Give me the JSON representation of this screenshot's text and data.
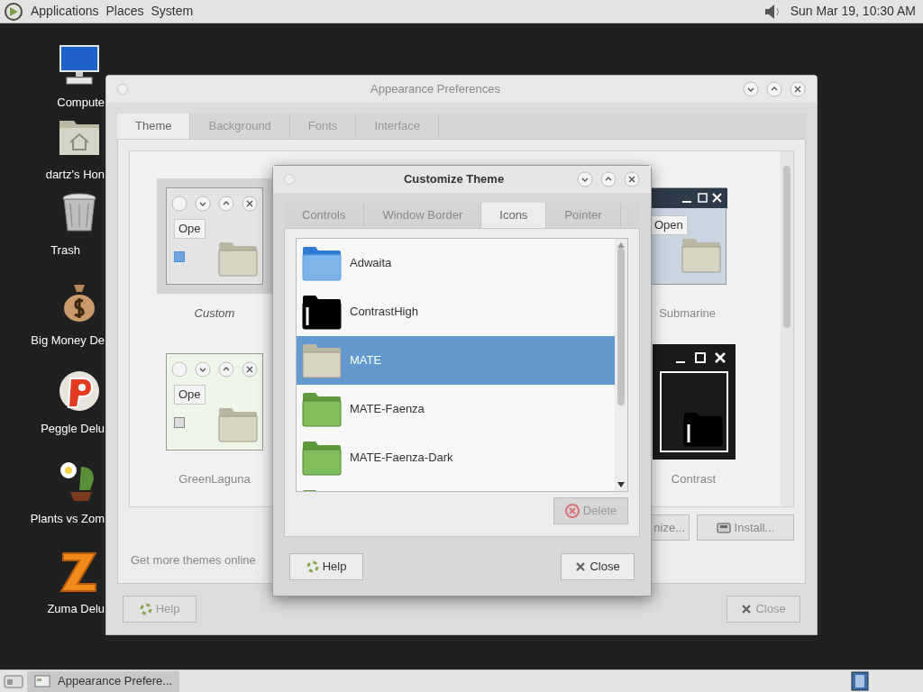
{
  "top_panel": {
    "menus": [
      {
        "label": "Applications"
      },
      {
        "label": "Places"
      },
      {
        "label": "System"
      }
    ],
    "clock": "Sun Mar 19, 10:30 AM"
  },
  "desktop_icons": [
    {
      "kind": "computer",
      "label": "Compute"
    },
    {
      "kind": "home",
      "label": "dartz's Hon"
    },
    {
      "kind": "trash",
      "label": "Trash"
    },
    {
      "kind": "money",
      "label": "Big Money De"
    },
    {
      "kind": "peggle",
      "label": "Peggle Delu"
    },
    {
      "kind": "plants",
      "label": "Plants vs Zom"
    },
    {
      "kind": "zuma",
      "label": "Zuma Delu"
    }
  ],
  "appearance_window": {
    "title": "Appearance Preferences",
    "active": false,
    "tabs": [
      {
        "label": "Theme",
        "selected": true
      },
      {
        "label": "Background",
        "selected": false
      },
      {
        "label": "Fonts",
        "selected": false
      },
      {
        "label": "Interface",
        "selected": false
      }
    ],
    "themes": [
      {
        "name": "Custom",
        "kind": "custom",
        "selected": true,
        "preview_button": "Ope"
      },
      {
        "name": "Submarine",
        "kind": "submarine",
        "selected": false,
        "preview_button": "Open"
      },
      {
        "name": "GreenLaguna",
        "kind": "green",
        "selected": false,
        "preview_button": "Ope"
      },
      {
        "name": "Contrast",
        "kind": "contrast",
        "selected": false
      }
    ],
    "link": "Get more themes online",
    "buttons": [
      {
        "kind": "customize",
        "label": "nize..."
      },
      {
        "kind": "install",
        "label": "Install..."
      }
    ],
    "footer_buttons": [
      {
        "kind": "help",
        "label": "Help"
      },
      {
        "kind": "close",
        "label": "Close"
      }
    ]
  },
  "customize_dialog": {
    "title": "Customize Theme",
    "active": true,
    "tabs": [
      {
        "label": "Controls",
        "selected": false
      },
      {
        "label": "Window Border",
        "selected": false
      },
      {
        "label": "Icons",
        "selected": true
      },
      {
        "label": "Pointer",
        "selected": false
      }
    ],
    "icon_themes": [
      {
        "kind": "blue",
        "name": "Adwaita",
        "selected": false
      },
      {
        "kind": "black",
        "name": "ContrastHigh",
        "selected": false
      },
      {
        "kind": "beige",
        "name": "MATE",
        "selected": true
      },
      {
        "kind": "green",
        "name": "MATE-Faenza",
        "selected": false
      },
      {
        "kind": "green",
        "name": "MATE-Faenza-Dark",
        "selected": false
      },
      {
        "kind": "green",
        "selected": false
      }
    ],
    "delete_button": {
      "label": "Delete",
      "disabled": true
    },
    "footer_buttons": [
      {
        "kind": "help",
        "label": "Help"
      },
      {
        "kind": "close",
        "label": "Close"
      }
    ]
  },
  "taskbar": {
    "tasks": [
      {
        "label": "Appearance Prefere...",
        "selected": true
      }
    ]
  }
}
